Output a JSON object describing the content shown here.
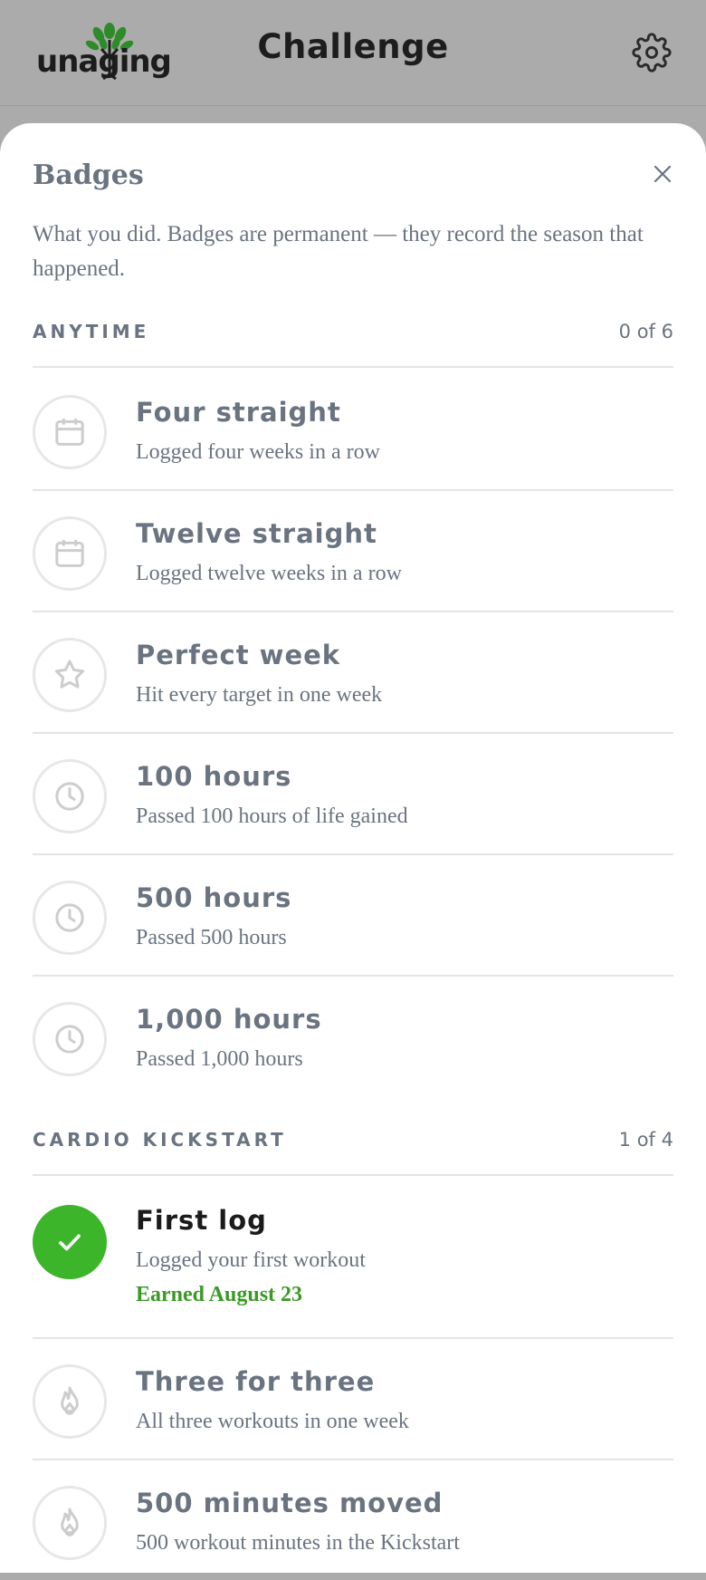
{
  "header": {
    "logo_text": "unaging",
    "title": "Challenge",
    "settings_icon": "gear-icon"
  },
  "sheet": {
    "title": "Badges",
    "close_icon": "close-icon",
    "intro": "What you did. Badges are permanent — they record the season that happened."
  },
  "sections": [
    {
      "label": "ANYTIME",
      "count": "0 of 6",
      "badges": [
        {
          "name": "Four straight",
          "desc": "Logged four weeks in a row",
          "icon": "calendar-icon"
        },
        {
          "name": "Twelve straight",
          "desc": "Logged twelve weeks in a row",
          "icon": "calendar-icon"
        },
        {
          "name": "Perfect week",
          "desc": "Hit every target in one week",
          "icon": "star-icon"
        },
        {
          "name": "100 hours",
          "desc": "Passed 100 hours of life gained",
          "icon": "clock-icon"
        },
        {
          "name": "500 hours",
          "desc": "Passed 500 hours",
          "icon": "clock-icon"
        },
        {
          "name": "1,000 hours",
          "desc": "Passed 1,000 hours",
          "icon": "clock-icon"
        }
      ]
    },
    {
      "label": "CARDIO KICKSTART",
      "count": "1 of 4",
      "badges": [
        {
          "name": "First log",
          "desc": "Logged your first workout",
          "earned": "Earned August 23",
          "icon": "check-icon"
        },
        {
          "name": "Three for three",
          "desc": "All three workouts in one week",
          "icon": "flame-icon"
        },
        {
          "name": "500 minutes moved",
          "desc": "500 workout minutes in the Kickstart",
          "icon": "flame-icon"
        }
      ]
    }
  ],
  "colors": {
    "overlay": "#ababab",
    "text_muted": "#6a7380",
    "earned_green": "#3db52a",
    "earned_text": "#3a9a25"
  }
}
